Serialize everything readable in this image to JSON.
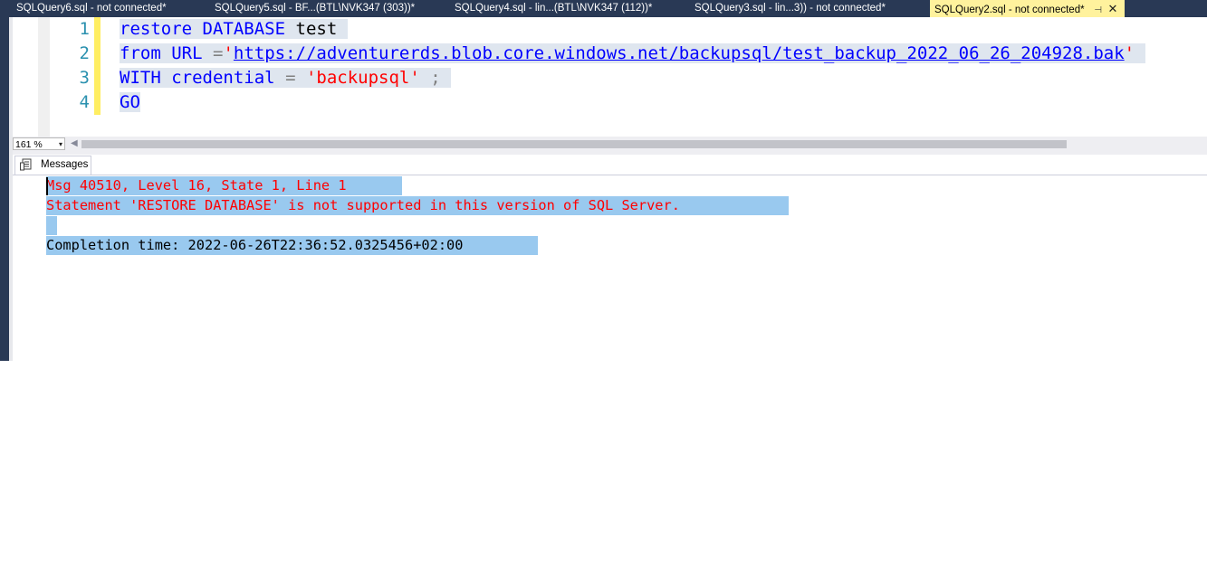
{
  "tabs": [
    {
      "label": "SQLQuery6.sql - not connected*",
      "active": false
    },
    {
      "label": "SQLQuery5.sql - BF...(BTL\\NVK347 (303))*",
      "active": false
    },
    {
      "label": "SQLQuery4.sql - lin...(BTL\\NVK347 (112))*",
      "active": false
    },
    {
      "label": "SQLQuery3.sql - lin...3)) - not connected*",
      "active": false
    },
    {
      "label": "SQLQuery2.sql - not connected*",
      "active": true
    }
  ],
  "tab_actions": {
    "pin": "⊣",
    "close": "✕"
  },
  "editor": {
    "lines": [
      {
        "num": "1",
        "kw1": "restore",
        "kw2": "DATABASE",
        "ident": "test"
      },
      {
        "num": "2",
        "kw1": "from",
        "ident": "URL",
        "op": "=",
        "quote_open": "'",
        "url": "https://adventurerds.blob.core.windows.net/backupsql/test_backup_2022_06_26_204928.bak",
        "quote_close": "'"
      },
      {
        "num": "3",
        "kw1": "WITH",
        "kw2": "credential",
        "op": "=",
        "string": "'backupsql'",
        "semicolon": ";"
      },
      {
        "num": "4",
        "kw1": "GO"
      }
    ]
  },
  "zoom": {
    "value": "161 %",
    "arrow": "▾"
  },
  "scroll": {
    "left_arrow": "◀"
  },
  "results": {
    "tab_label": "Messages",
    "messages": [
      {
        "text": "Msg 40510, Level 16, State 1, Line 1",
        "type": "error"
      },
      {
        "text": "Statement 'RESTORE DATABASE' is not supported in this version of SQL Server.",
        "type": "error"
      },
      {
        "text": " ",
        "type": "blank"
      },
      {
        "text": "Completion time: 2022-06-26T22:36:52.0325456+02:00",
        "type": "normal"
      }
    ]
  },
  "colors": {
    "tab_bar": "#293955",
    "active_tab": "#fff29d",
    "keyword": "#0000ff",
    "string": "#ff0000",
    "line_number": "#2b91af",
    "change_marker": "#ffee62",
    "selection": "#99c9ef",
    "error_text": "#ff0000"
  },
  "icons": {
    "messages": "messages-icon",
    "pin": "pin-icon",
    "close": "close-icon",
    "dropdown": "chevron-down-icon"
  }
}
